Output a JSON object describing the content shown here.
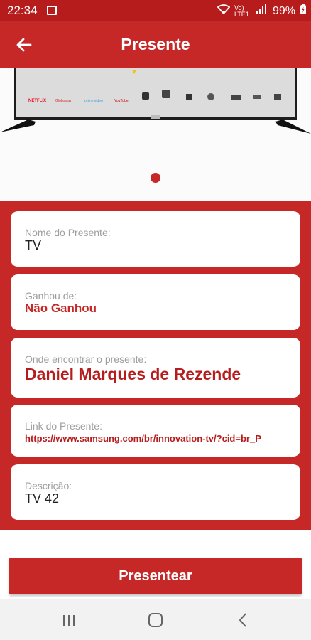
{
  "status_bar": {
    "time": "22:34",
    "network": "Vo) LTE1",
    "battery": "99%"
  },
  "app_bar": {
    "title": "Presente",
    "back_icon": "arrow-back-icon"
  },
  "carousel": {
    "image_description": "tv-product-image",
    "apps": [
      "NETFLIX",
      "Globoplay",
      "prime video",
      "YouTube"
    ],
    "active_page": 1,
    "page_count": 1
  },
  "fields": {
    "name": {
      "label": "Nome do Presente:",
      "value": "TV"
    },
    "won_from": {
      "label": "Ganhou de:",
      "value": "Não Ganhou"
    },
    "where": {
      "label": "Onde encontrar o presente:",
      "value": "Daniel Marques de Rezende"
    },
    "link": {
      "label": "Link do Presente:",
      "value": "https://www.samsung.com/br/innovation-tv/?cid=br_P"
    },
    "description": {
      "label": "Descrição:",
      "value": "TV 42"
    }
  },
  "actions": {
    "present_label": "Presentear"
  },
  "colors": {
    "primary": "#c62828",
    "status_bar": "#b71c1c",
    "accent_text": "#c62828",
    "label_gray": "#9e9e9e"
  }
}
